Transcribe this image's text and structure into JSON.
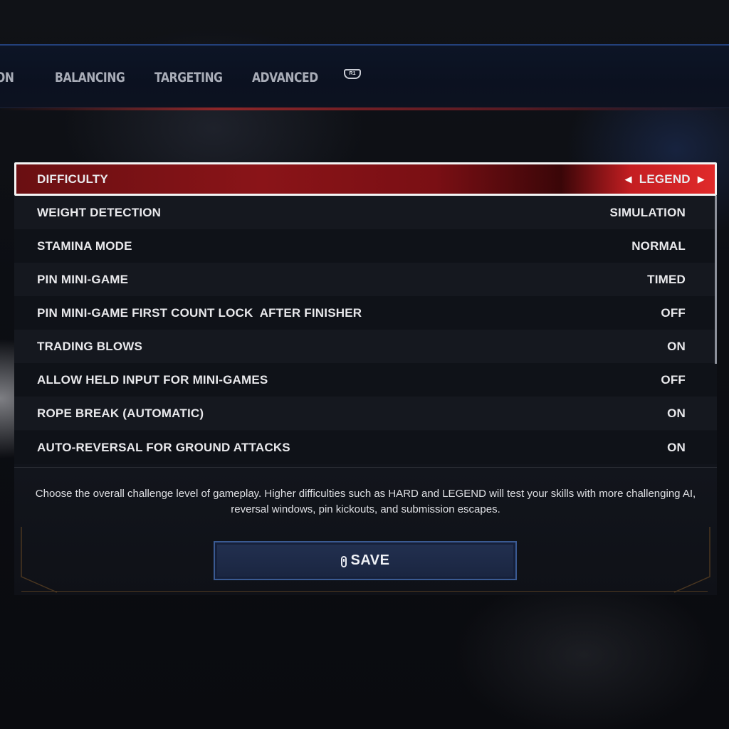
{
  "tabs": [
    {
      "label": "ON"
    },
    {
      "label": "BALANCING"
    },
    {
      "label": "TARGETING"
    },
    {
      "label": "ADVANCED"
    }
  ],
  "next_tab_hint": "R1",
  "settings": [
    {
      "label": "DIFFICULTY",
      "value": "LEGEND"
    },
    {
      "label": "WEIGHT DETECTION",
      "value": "SIMULATION"
    },
    {
      "label": "STAMINA MODE",
      "value": "NORMAL"
    },
    {
      "label": "PIN MINI-GAME",
      "value": "TIMED"
    },
    {
      "label": "PIN MINI-GAME FIRST COUNT LOCK  AFTER FINISHER",
      "value": "OFF"
    },
    {
      "label": "TRADING BLOWS",
      "value": "ON"
    },
    {
      "label": "ALLOW HELD INPUT FOR MINI-GAMES",
      "value": "OFF"
    },
    {
      "label": "ROPE BREAK (AUTOMATIC)",
      "value": "ON"
    },
    {
      "label": "AUTO-REVERSAL FOR GROUND ATTACKS",
      "value": "ON"
    }
  ],
  "description": "Choose the overall challenge level of gameplay. Higher difficulties such as HARD and LEGEND will test your skills with more challenging AI, reversal windows, pin kickouts, and submission escapes.",
  "save_label": "SAVE",
  "icons": {
    "left": "triangle-left",
    "right": "triangle-right",
    "save": "controller-button-icon"
  },
  "colors": {
    "selected": "#8a1418",
    "accent_blue": "#3a5a92"
  }
}
